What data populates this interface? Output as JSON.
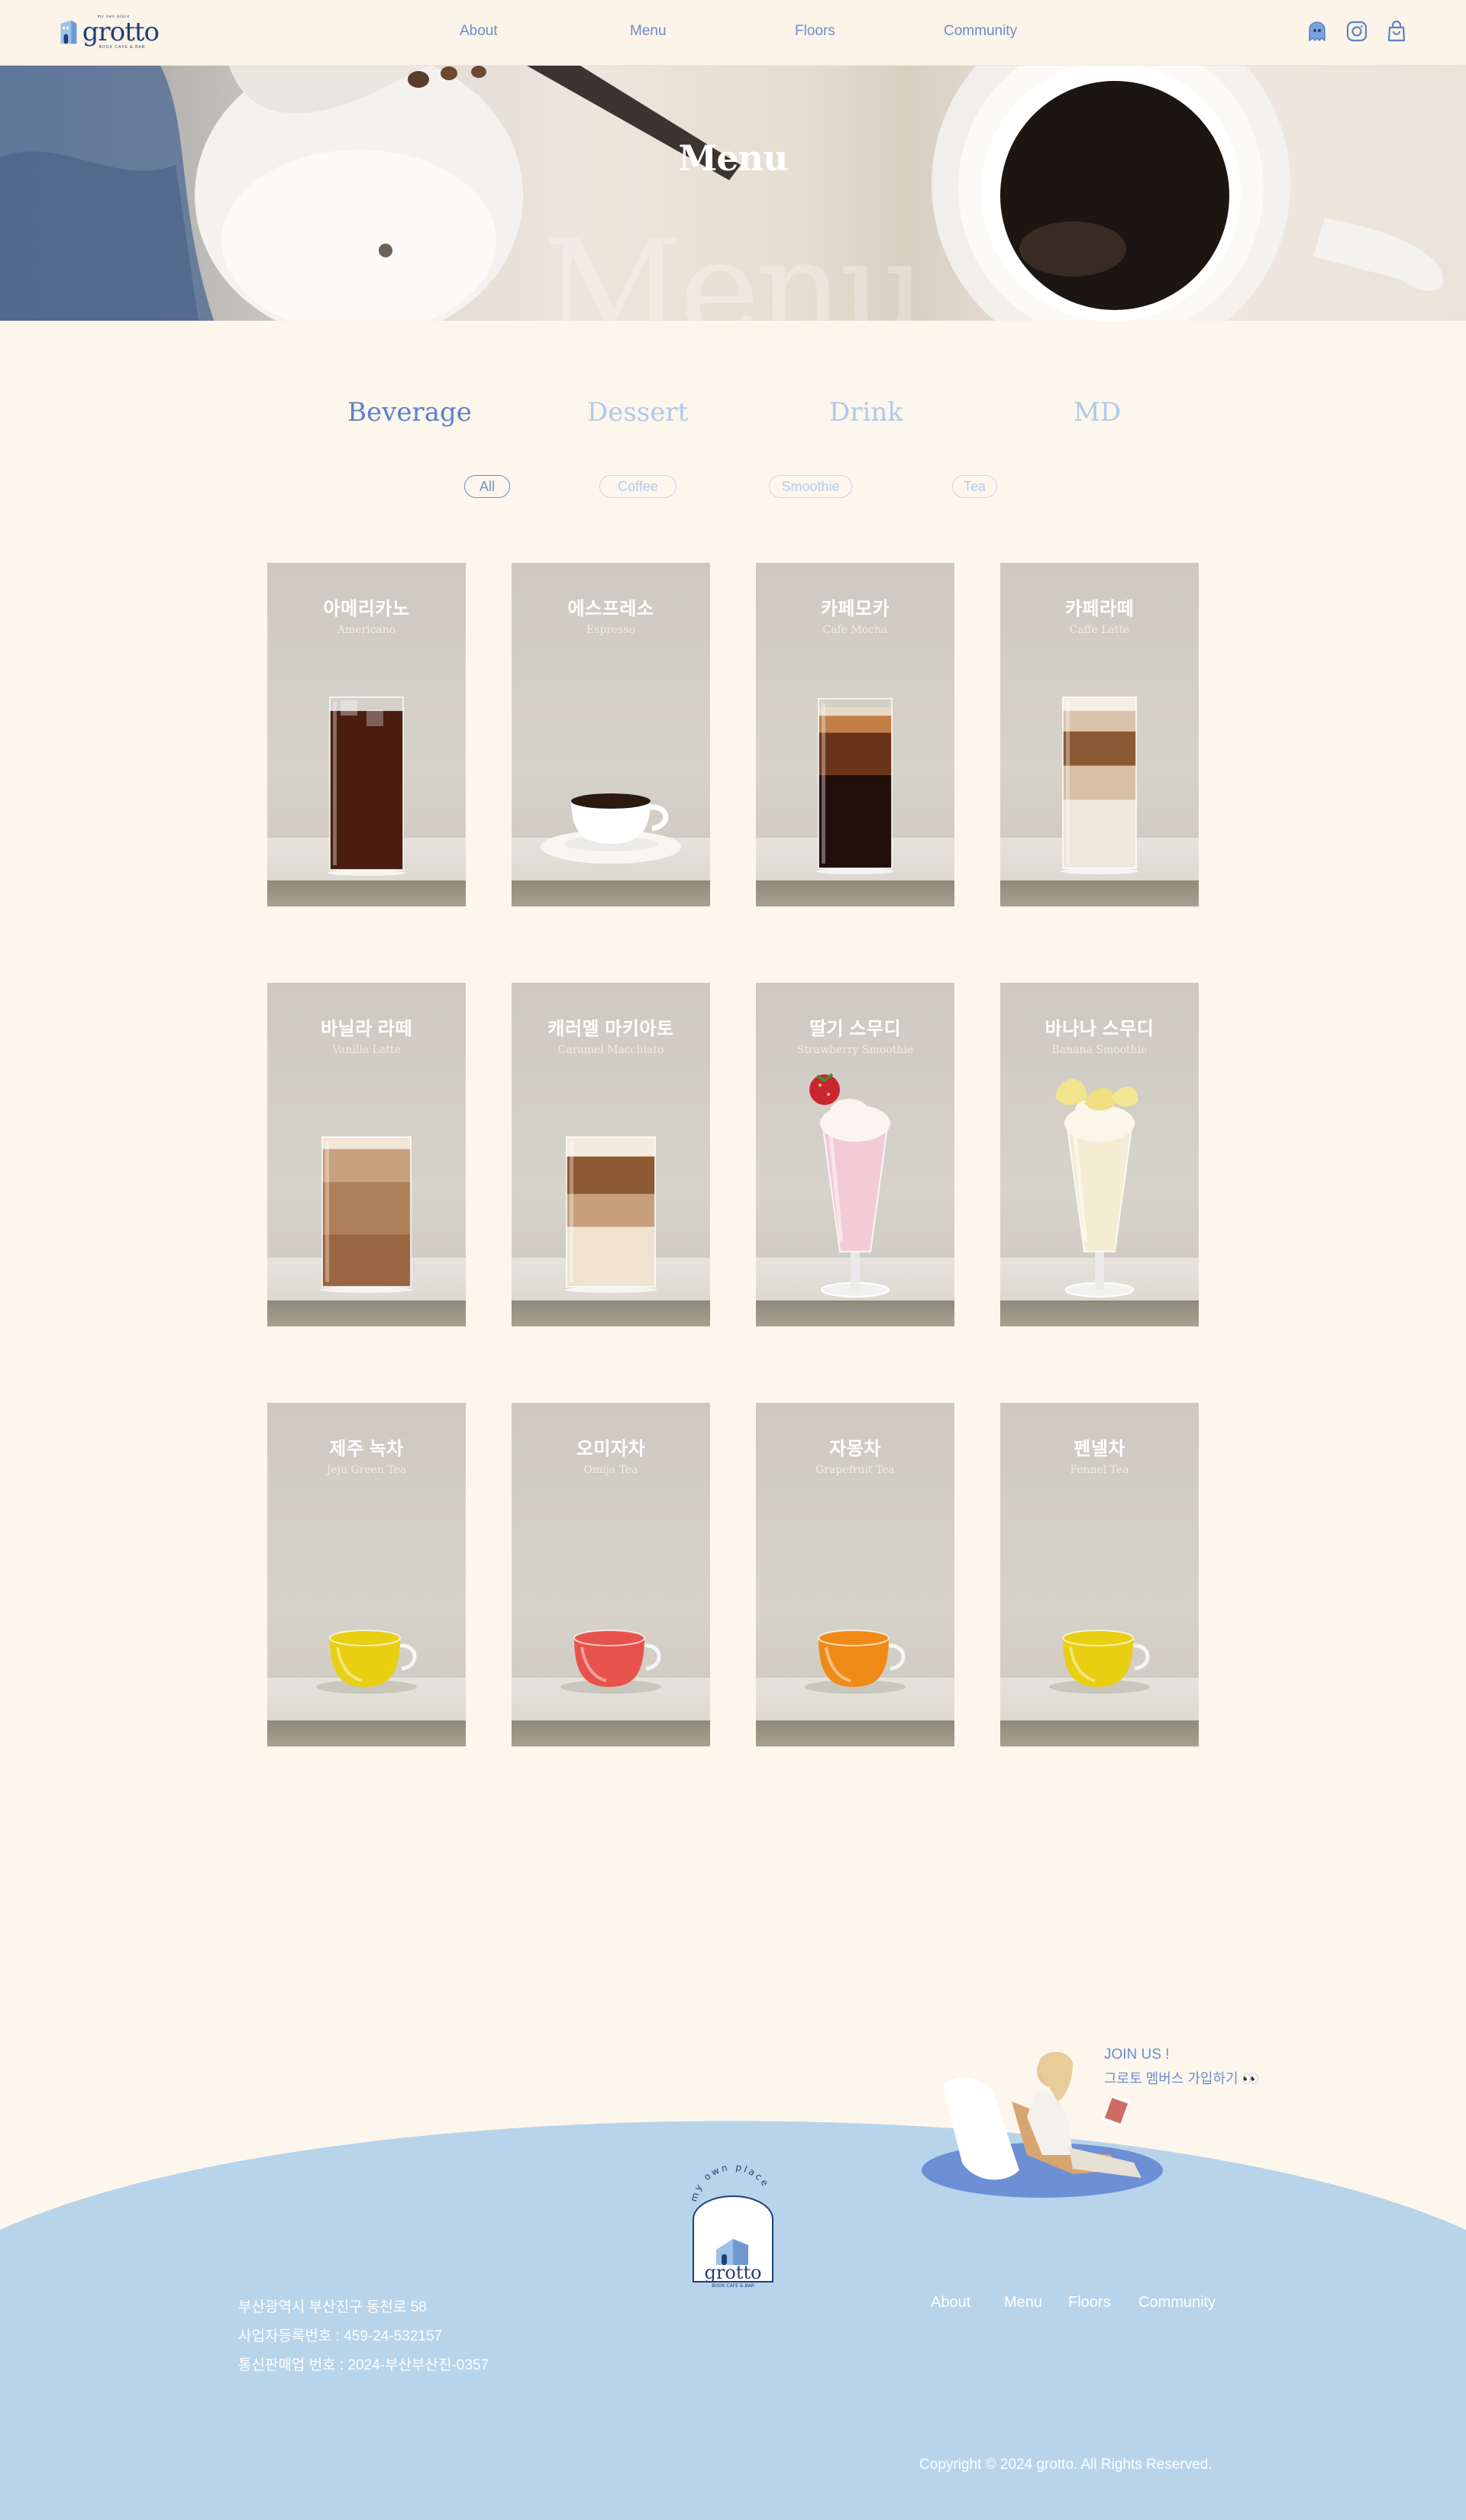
{
  "header": {
    "logo": {
      "name": "grotto",
      "tagline_top": "my own place",
      "tagline_bottom": "BOOK CAFE & BAR"
    },
    "nav": [
      {
        "label": "About"
      },
      {
        "label": "Menu"
      },
      {
        "label": "Floors"
      },
      {
        "label": "Community"
      }
    ],
    "icons": [
      "ghost-icon",
      "instagram-icon",
      "shopping-bag-icon"
    ]
  },
  "hero": {
    "title": "Menu",
    "ghost_text": "Menu"
  },
  "categories": [
    {
      "label": "Beverage",
      "active": true
    },
    {
      "label": "Dessert",
      "active": false
    },
    {
      "label": "Drink",
      "active": false
    },
    {
      "label": "MD",
      "active": false
    }
  ],
  "filters": [
    {
      "label": "All",
      "active": true
    },
    {
      "label": "Coffee",
      "active": false
    },
    {
      "label": "Smoothie",
      "active": false
    },
    {
      "label": "Tea",
      "active": false
    }
  ],
  "menu": [
    {
      "ko": "아메리카노",
      "en": "Americano",
      "drink": "iced-americano"
    },
    {
      "ko": "에스프레소",
      "en": "Espresso",
      "drink": "espresso-cup"
    },
    {
      "ko": "카페모카",
      "en": "Cafe Mocha",
      "drink": "mocha-glass"
    },
    {
      "ko": "카페라떼",
      "en": "Caffe Latte",
      "drink": "latte-glass"
    },
    {
      "ko": "바닐라 라떼",
      "en": "Vanilla Latte",
      "drink": "vanilla-latte"
    },
    {
      "ko": "캐러멜 마키아토",
      "en": "Caramel Macchiato",
      "drink": "caramel-macchiato"
    },
    {
      "ko": "딸기 스무디",
      "en": "Strawberry Smoothie",
      "drink": "strawberry-smoothie"
    },
    {
      "ko": "바나나 스무디",
      "en": "Banana Smoothie",
      "drink": "banana-smoothie"
    },
    {
      "ko": "제주 녹차",
      "en": "Jeju Green Tea",
      "drink": "tea-yellow"
    },
    {
      "ko": "오미자차",
      "en": "Omija Tea",
      "drink": "tea-red"
    },
    {
      "ko": "자몽차",
      "en": "Grapefruit Tea",
      "drink": "tea-orange"
    },
    {
      "ko": "펜넬차",
      "en": "Fennel Tea",
      "drink": "tea-yellow"
    }
  ],
  "footer": {
    "join_title": "JOIN US !",
    "join_text": "그로토 멤버스 가입하기 👀",
    "badge_arc": "my own place",
    "badge_name": "grotto",
    "badge_sub": "BOOK CAFE & BAR",
    "info": [
      "부산광역시 부산진구 동천로 58",
      "사업자등록번호 : 459-24-532157",
      "통신판매업 번호 : 2024-부산부산진-0357"
    ],
    "nav": [
      {
        "label": "About"
      },
      {
        "label": "Menu"
      },
      {
        "label": "Floors"
      },
      {
        "label": "Community"
      }
    ],
    "copyright": "Copyright © 2024 grotto. All Rights Reserved."
  },
  "colors": {
    "background": "#fdf6ec",
    "accent": "#6b8ed0",
    "footer_blue": "#b8d4ea",
    "navy": "#1f4077"
  }
}
